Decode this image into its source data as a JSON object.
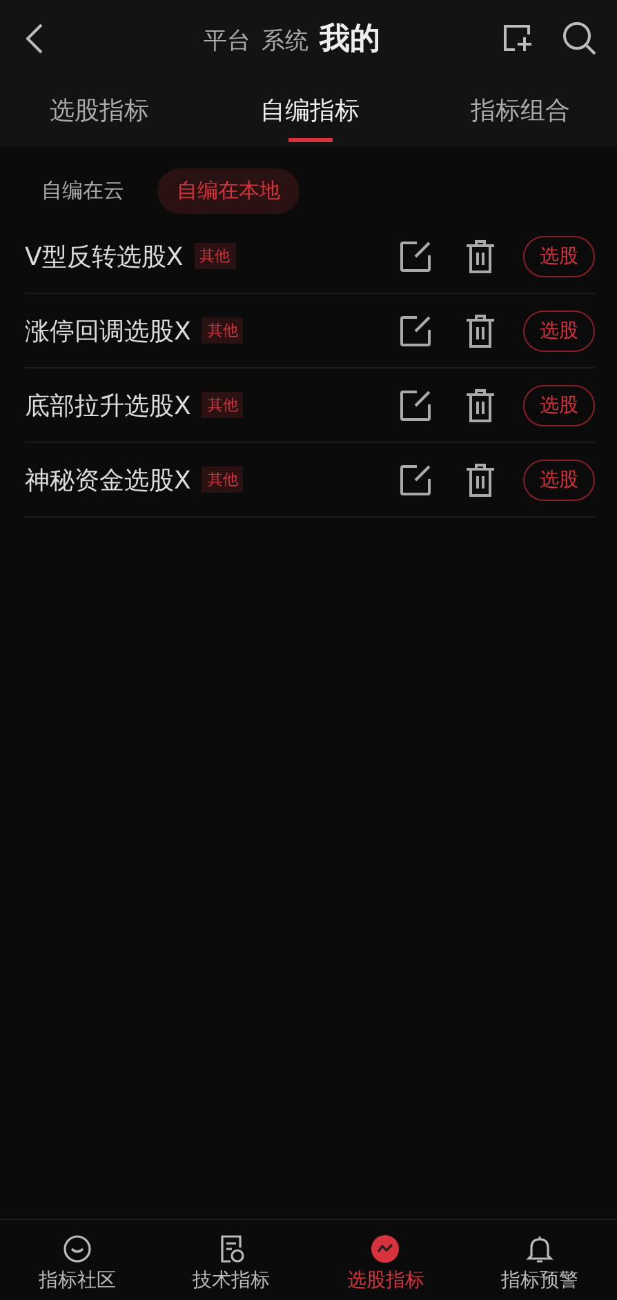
{
  "header": {
    "source_tabs": [
      {
        "label": "平台",
        "selected": false
      },
      {
        "label": "系统",
        "selected": false
      },
      {
        "label": "我的",
        "selected": true
      }
    ]
  },
  "tabs": [
    {
      "label": "选股指标",
      "selected": false
    },
    {
      "label": "自编指标",
      "selected": true
    },
    {
      "label": "指标组合",
      "selected": false
    }
  ],
  "segments": [
    {
      "label": "自编在云",
      "selected": false
    },
    {
      "label": "自编在本地",
      "selected": true
    }
  ],
  "formulas": [
    {
      "name": "V型反转选股X",
      "tag": "其他",
      "action": "选股"
    },
    {
      "name": "涨停回调选股X",
      "tag": "其他",
      "action": "选股"
    },
    {
      "name": "底部拉升选股X",
      "tag": "其他",
      "action": "选股"
    },
    {
      "name": "神秘资金选股X",
      "tag": "其他",
      "action": "选股"
    }
  ],
  "bottom_nav": [
    {
      "label": "指标社区",
      "selected": false
    },
    {
      "label": "技术指标",
      "selected": false
    },
    {
      "label": "选股指标",
      "selected": true
    },
    {
      "label": "指标预警",
      "selected": false
    }
  ]
}
